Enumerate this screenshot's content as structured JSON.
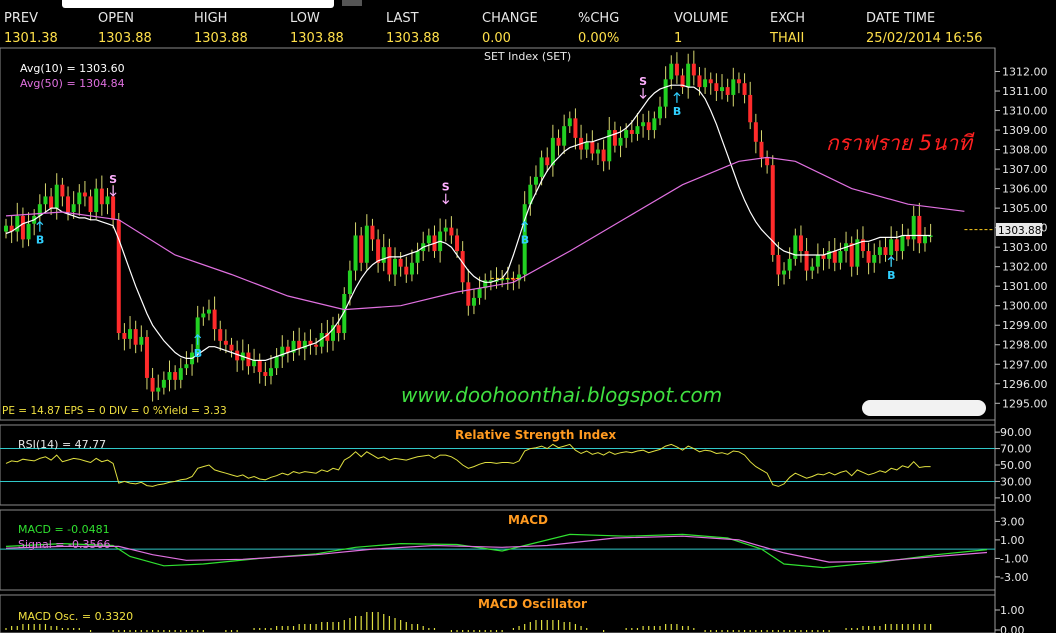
{
  "quote": {
    "columns": [
      {
        "label": "PREV",
        "value": "1301.38",
        "x": 4
      },
      {
        "label": "OPEN",
        "value": "1303.88",
        "x": 98
      },
      {
        "label": "HIGH",
        "value": "1303.88",
        "x": 194
      },
      {
        "label": "LOW",
        "value": "1303.88",
        "x": 290
      },
      {
        "label": "LAST",
        "value": "1303.88",
        "x": 386
      },
      {
        "label": "CHANGE",
        "value": "0.00",
        "x": 482
      },
      {
        "label": "%CHG",
        "value": "0.00%",
        "x": 578
      },
      {
        "label": "VOLUME",
        "value": "1",
        "x": 674
      },
      {
        "label": "EXCH",
        "value": "THAII",
        "x": 770
      },
      {
        "label": "DATE TIME",
        "value": "25/02/2014 16:56",
        "x": 866
      }
    ]
  },
  "chart_data": [
    {
      "type": "candlestick",
      "title": "SET Index (SET)",
      "ylim": [
        1294.4,
        1313
      ],
      "yticks": [
        1295,
        1296,
        1297,
        1298,
        1299,
        1300,
        1301,
        1302,
        1303,
        1304,
        1305,
        1306,
        1307,
        1308,
        1309,
        1310,
        1311,
        1312
      ],
      "last_label": "1303.88",
      "legend": [
        {
          "name": "Avg(10)",
          "value": "1303.60",
          "color": "#ffffff"
        },
        {
          "name": "Avg(50)",
          "value": "1304.84",
          "color": "#e070e0"
        }
      ],
      "fundamentals": "PE = 14.87   EPS = 0   DIV = 0   %Yield = 3.33",
      "annotation": "กราฟราย 5นาที",
      "watermark": "www.doohoonthai.blogspot.com",
      "signals": [
        {
          "label": "B",
          "index": 6,
          "color": "#30d0ff"
        },
        {
          "label": "S",
          "index": 19,
          "color": "#ffb0ff"
        },
        {
          "label": "B",
          "index": 34,
          "color": "#30d0ff"
        },
        {
          "label": "S",
          "index": 78,
          "color": "#ffb0ff"
        },
        {
          "label": "B",
          "index": 92,
          "color": "#30d0ff"
        },
        {
          "label": "S",
          "index": 113,
          "color": "#ffb0ff"
        },
        {
          "label": "B",
          "index": 119,
          "color": "#30d0ff"
        },
        {
          "label": "B",
          "index": 157,
          "color": "#30d0ff"
        }
      ],
      "close": [
        1304.1,
        1303.8,
        1304.6,
        1303.4,
        1304.2,
        1304.6,
        1305.2,
        1305.6,
        1305.0,
        1306.2,
        1305.6,
        1304.8,
        1305.2,
        1305.8,
        1305.6,
        1304.8,
        1306.0,
        1305.2,
        1305.6,
        1304.4,
        1298.6,
        1298.3,
        1298.8,
        1298.0,
        1298.4,
        1296.3,
        1295.6,
        1295.8,
        1296.2,
        1296.6,
        1296.2,
        1296.8,
        1297.0,
        1297.6,
        1299.4,
        1299.6,
        1299.8,
        1298.8,
        1298.2,
        1298.0,
        1297.7,
        1297.2,
        1297.6,
        1296.9,
        1297.2,
        1296.6,
        1296.4,
        1296.8,
        1297.4,
        1297.9,
        1297.6,
        1298.2,
        1297.8,
        1298.2,
        1298.0,
        1297.9,
        1298.6,
        1298.2,
        1299.0,
        1298.6,
        1300.6,
        1301.8,
        1303.6,
        1302.2,
        1304.1,
        1303.4,
        1302.2,
        1303.0,
        1301.6,
        1302.4,
        1302.0,
        1301.6,
        1302.2,
        1302.8,
        1303.2,
        1303.6,
        1302.8,
        1303.8,
        1304.0,
        1303.6,
        1302.8,
        1301.2,
        1300.0,
        1300.4,
        1300.9,
        1301.3,
        1301.3,
        1301.3,
        1301.4,
        1301.4,
        1301.3,
        1301.6,
        1305.2,
        1306.2,
        1306.6,
        1307.6,
        1307.2,
        1308.6,
        1308.2,
        1309.2,
        1309.6,
        1308.6,
        1308.0,
        1308.4,
        1307.8,
        1308.0,
        1307.4,
        1309.0,
        1308.2,
        1308.6,
        1309.0,
        1308.8,
        1309.2,
        1309.4,
        1309.0,
        1309.6,
        1310.2,
        1311.6,
        1312.4,
        1311.8,
        1311.2,
        1312.4,
        1311.8,
        1311.2,
        1311.6,
        1311.4,
        1311.0,
        1311.2,
        1310.8,
        1311.6,
        1311.4,
        1310.8,
        1309.4,
        1308.4,
        1307.6,
        1307.2,
        1302.6,
        1301.6,
        1301.8,
        1302.4,
        1303.6,
        1302.8,
        1301.8,
        1302.0,
        1302.6,
        1302.4,
        1302.8,
        1302.2,
        1302.8,
        1303.2,
        1302.0,
        1303.4,
        1302.8,
        1302.2,
        1302.6,
        1303.0,
        1302.6,
        1303.4,
        1302.8,
        1303.6,
        1303.4,
        1304.6,
        1303.2,
        1303.6,
        1303.6
      ],
      "avg10": [
        1303.7,
        1303.8,
        1304.0,
        1304.2,
        1304.3,
        1304.4,
        1304.6,
        1304.8,
        1305.0,
        1305.0,
        1304.8,
        1304.7,
        1304.6,
        1304.5,
        1304.5,
        1304.4,
        1304.4,
        1304.3,
        1304.2,
        1304.1,
        1303.4,
        1302.6,
        1301.8,
        1301.0,
        1300.3,
        1299.6,
        1299.0,
        1298.6,
        1298.2,
        1297.9,
        1297.6,
        1297.4,
        1297.3,
        1297.3,
        1297.5,
        1297.7,
        1297.9,
        1297.9,
        1297.8,
        1297.7,
        1297.6,
        1297.5,
        1297.4,
        1297.3,
        1297.2,
        1297.2,
        1297.2,
        1297.3,
        1297.4,
        1297.5,
        1297.6,
        1297.7,
        1297.8,
        1297.9,
        1298.0,
        1298.1,
        1298.3,
        1298.5,
        1298.8,
        1299.2,
        1299.7,
        1300.3,
        1300.9,
        1301.4,
        1301.8,
        1302.1,
        1302.3,
        1302.4,
        1302.5,
        1302.5,
        1302.5,
        1302.6,
        1302.7,
        1302.8,
        1303.0,
        1303.1,
        1303.2,
        1303.3,
        1303.2,
        1303.0,
        1302.6,
        1302.2,
        1301.8,
        1301.5,
        1301.3,
        1301.2,
        1301.2,
        1301.3,
        1301.4,
        1301.8,
        1302.6,
        1303.5,
        1304.4,
        1305.2,
        1305.8,
        1306.4,
        1306.9,
        1307.3,
        1307.6,
        1307.9,
        1308.1,
        1308.2,
        1308.3,
        1308.4,
        1308.4,
        1308.5,
        1308.6,
        1308.7,
        1308.8,
        1308.9,
        1309.1,
        1309.4,
        1309.8,
        1310.2,
        1310.6,
        1310.9,
        1311.1,
        1311.2,
        1311.3,
        1311.3,
        1311.3,
        1311.2,
        1311.2,
        1311.0,
        1310.6,
        1310.0,
        1309.3,
        1308.5,
        1307.7,
        1306.9,
        1306.1,
        1305.4,
        1304.8,
        1304.3,
        1303.9,
        1303.6,
        1303.3,
        1303.0,
        1302.8,
        1302.7,
        1302.6,
        1302.6,
        1302.6,
        1302.6,
        1302.6,
        1302.6,
        1302.7,
        1302.8,
        1302.9,
        1303.0,
        1303.1,
        1303.2,
        1303.3,
        1303.3,
        1303.4,
        1303.5,
        1303.5,
        1303.5,
        1303.5,
        1303.6,
        1303.6,
        1303.6,
        1303.6,
        1303.6,
        1303.6
      ],
      "avg50_points": [
        [
          0,
          1304.6
        ],
        [
          10,
          1304.8
        ],
        [
          20,
          1304.4
        ],
        [
          30,
          1302.6
        ],
        [
          40,
          1301.6
        ],
        [
          50,
          1300.5
        ],
        [
          60,
          1299.8
        ],
        [
          70,
          1300.0
        ],
        [
          80,
          1300.7
        ],
        [
          90,
          1301.2
        ],
        [
          100,
          1302.8
        ],
        [
          110,
          1304.5
        ],
        [
          120,
          1306.2
        ],
        [
          130,
          1307.4
        ],
        [
          135,
          1307.6
        ],
        [
          140,
          1307.4
        ],
        [
          150,
          1306.0
        ],
        [
          160,
          1305.2
        ],
        [
          170,
          1304.84
        ]
      ],
      "dashed_marks": [
        {
          "from": 86,
          "to": 91,
          "value": 1301.4
        },
        {
          "from": 170,
          "to": 175,
          "value": 1303.9
        }
      ]
    },
    {
      "type": "line",
      "title": "Relative Strength Index",
      "ylim": [
        5,
        95
      ],
      "yticks": [
        90,
        70,
        50,
        30,
        10
      ],
      "tick_labels": [
        "90.00",
        "70.00",
        "50.00",
        "30.00",
        "10.00"
      ],
      "levels": [
        70,
        30
      ],
      "legend": "RSI(14)  =  47.77",
      "values": [
        52,
        55,
        54,
        57,
        56,
        55,
        58,
        60,
        56,
        62,
        54,
        56,
        58,
        57,
        55,
        53,
        58,
        54,
        56,
        52,
        28,
        30,
        28,
        27,
        29,
        25,
        24,
        26,
        27,
        29,
        30,
        32,
        33,
        36,
        46,
        48,
        50,
        44,
        42,
        40,
        38,
        36,
        38,
        34,
        36,
        33,
        32,
        35,
        37,
        40,
        38,
        42,
        40,
        42,
        41,
        40,
        44,
        42,
        46,
        44,
        56,
        60,
        66,
        60,
        66,
        62,
        58,
        60,
        56,
        58,
        57,
        56,
        58,
        60,
        61,
        62,
        58,
        62,
        62,
        60,
        56,
        50,
        46,
        48,
        51,
        53,
        53,
        52,
        53,
        53,
        52,
        55,
        67,
        70,
        71,
        73,
        70,
        75,
        71,
        73,
        75,
        68,
        64,
        67,
        63,
        65,
        62,
        66,
        63,
        65,
        66,
        65,
        67,
        68,
        65,
        67,
        69,
        73,
        75,
        72,
        68,
        73,
        70,
        66,
        68,
        67,
        64,
        65,
        63,
        67,
        66,
        62,
        54,
        48,
        44,
        40,
        26,
        24,
        27,
        35,
        40,
        37,
        34,
        36,
        39,
        38,
        41,
        38,
        41,
        43,
        37,
        44,
        41,
        38,
        40,
        43,
        41,
        46,
        44,
        49,
        47,
        54,
        47,
        48,
        48
      ]
    },
    {
      "type": "line",
      "title": "MACD",
      "ylim": [
        -4.2,
        3.8
      ],
      "yticks": [
        3,
        1,
        -1,
        -3
      ],
      "tick_labels": [
        "3.00",
        "1.00",
        "-1.00",
        "-3.00"
      ],
      "legend": [
        {
          "name": "MACD",
          "value": "-0.0481",
          "color": "#30e030"
        },
        {
          "name": "Signal",
          "value": "-0.3566",
          "color": "#e070e0"
        }
      ],
      "zero": 0,
      "macd_points": [
        [
          0,
          0.3
        ],
        [
          10,
          0.6
        ],
        [
          19,
          0.4
        ],
        [
          22,
          -0.8
        ],
        [
          28,
          -1.8
        ],
        [
          35,
          -1.6
        ],
        [
          45,
          -1.0
        ],
        [
          55,
          -0.5
        ],
        [
          62,
          0.2
        ],
        [
          70,
          0.6
        ],
        [
          80,
          0.5
        ],
        [
          88,
          -0.2
        ],
        [
          92,
          0.4
        ],
        [
          100,
          1.6
        ],
        [
          110,
          1.4
        ],
        [
          120,
          1.6
        ],
        [
          128,
          1.2
        ],
        [
          134,
          0.0
        ],
        [
          138,
          -1.6
        ],
        [
          145,
          -2.0
        ],
        [
          155,
          -1.4
        ],
        [
          165,
          -0.6
        ],
        [
          174,
          -0.05
        ]
      ],
      "signal_points": [
        [
          0,
          0.1
        ],
        [
          10,
          0.3
        ],
        [
          20,
          0.3
        ],
        [
          26,
          -0.6
        ],
        [
          32,
          -1.2
        ],
        [
          42,
          -1.1
        ],
        [
          55,
          -0.6
        ],
        [
          65,
          0.0
        ],
        [
          76,
          0.4
        ],
        [
          88,
          0.2
        ],
        [
          96,
          0.4
        ],
        [
          108,
          1.2
        ],
        [
          120,
          1.4
        ],
        [
          130,
          1.0
        ],
        [
          138,
          -0.4
        ],
        [
          146,
          -1.4
        ],
        [
          155,
          -1.3
        ],
        [
          165,
          -0.8
        ],
        [
          174,
          -0.36
        ]
      ]
    },
    {
      "type": "bar",
      "title": "MACD Oscillator",
      "ylim": [
        -1.0,
        1.6
      ],
      "yticks": [
        1,
        0
      ],
      "tick_labels": [
        "1.00",
        "0.00"
      ],
      "legend": "MACD Osc.  =  0.3320",
      "values": [
        0.1,
        0.2,
        0.2,
        0.3,
        0.3,
        0.3,
        0.3,
        0.3,
        0.2,
        0.2,
        0.1,
        0.1,
        0.1,
        0.1,
        0.0,
        -0.1,
        0.0,
        0.0,
        0.0,
        -0.1,
        -0.4,
        -0.6,
        -0.8,
        -0.9,
        -1.0,
        -1.0,
        -0.9,
        -0.9,
        -0.8,
        -0.7,
        -0.6,
        -0.5,
        -0.4,
        -0.3,
        -0.1,
        -0.1,
        0.0,
        0.0,
        0.0,
        -0.1,
        -0.1,
        -0.1,
        0.0,
        0.0,
        0.1,
        0.1,
        0.1,
        0.1,
        0.2,
        0.2,
        0.2,
        0.2,
        0.3,
        0.3,
        0.3,
        0.3,
        0.4,
        0.4,
        0.4,
        0.4,
        0.5,
        0.6,
        0.7,
        0.7,
        0.9,
        0.9,
        0.9,
        0.8,
        0.7,
        0.6,
        0.5,
        0.4,
        0.3,
        0.3,
        0.2,
        0.1,
        0.1,
        0.0,
        0.0,
        -0.1,
        -0.2,
        -0.4,
        -0.5,
        -0.5,
        -0.4,
        -0.3,
        -0.3,
        -0.2,
        -0.1,
        0.0,
        0.1,
        0.2,
        0.3,
        0.4,
        0.5,
        0.5,
        0.5,
        0.5,
        0.5,
        0.4,
        0.4,
        0.3,
        0.2,
        0.1,
        0.0,
        0.0,
        -0.1,
        0.0,
        0.0,
        0.0,
        0.1,
        0.1,
        0.1,
        0.2,
        0.2,
        0.2,
        0.2,
        0.3,
        0.3,
        0.3,
        0.2,
        0.2,
        0.1,
        0.0,
        -0.1,
        -0.2,
        -0.3,
        -0.5,
        -0.7,
        -0.8,
        -0.9,
        -1.0,
        -1.0,
        -0.9,
        -0.9,
        -0.8,
        -0.8,
        -0.7,
        -0.6,
        -0.5,
        -0.4,
        -0.4,
        -0.3,
        -0.2,
        -0.2,
        -0.1,
        -0.1,
        0.0,
        0.0,
        0.1,
        0.1,
        0.1,
        0.2,
        0.2,
        0.2,
        0.2,
        0.3,
        0.3,
        0.3,
        0.3,
        0.3,
        0.3,
        0.3,
        0.3,
        0.3
      ]
    }
  ]
}
